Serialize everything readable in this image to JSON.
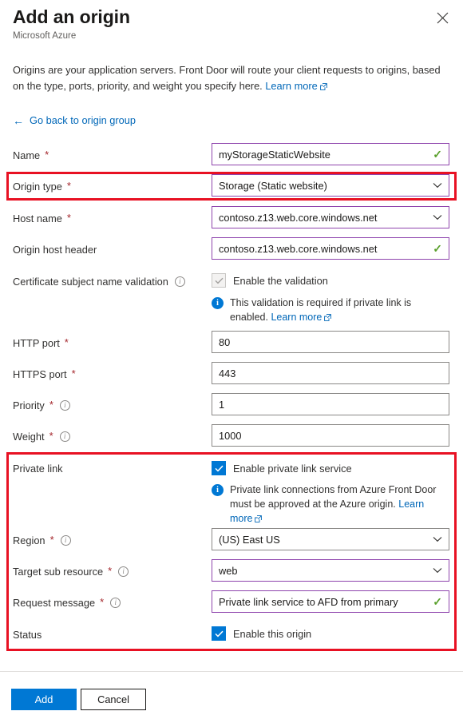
{
  "header": {
    "title": "Add an origin",
    "subtitle": "Microsoft Azure",
    "close_icon": "close-icon"
  },
  "intro": {
    "text": "Origins are your application servers. Front Door will route your client requests to origins, based on the type, ports, priority, and weight you specify here. ",
    "learn_more": "Learn more"
  },
  "back_link": {
    "arrow": "←",
    "label": "Go back to origin group"
  },
  "fields": {
    "name": {
      "label": "Name",
      "required": "*",
      "value": "myStorageStaticWebsite",
      "validation": "✓"
    },
    "origin_type": {
      "label": "Origin type",
      "required": "*",
      "value": "Storage (Static website)"
    },
    "host_name": {
      "label": "Host name",
      "required": "*",
      "value": "contoso.z13.web.core.windows.net"
    },
    "origin_host_header": {
      "label": "Origin host header",
      "value": "contoso.z13.web.core.windows.net",
      "validation": "✓"
    },
    "cert_validation": {
      "label": "Certificate subject name validation",
      "checkbox_label": "Enable the validation",
      "checked": true,
      "disabled": true,
      "info_text": "This validation is required if private link is enabled. ",
      "info_link": "Learn more"
    },
    "http_port": {
      "label": "HTTP port",
      "required": "*",
      "value": "80"
    },
    "https_port": {
      "label": "HTTPS port",
      "required": "*",
      "value": "443"
    },
    "priority": {
      "label": "Priority",
      "required": "*",
      "value": "1"
    },
    "weight": {
      "label": "Weight",
      "required": "*",
      "value": "1000"
    },
    "private_link": {
      "label": "Private link",
      "checkbox_label": "Enable private link service",
      "checked": true,
      "info_text": "Private link connections from Azure Front Door must be approved at the Azure origin. ",
      "info_link": "Learn more"
    },
    "region": {
      "label": "Region",
      "required": "*",
      "value": "(US) East US"
    },
    "target_sub_resource": {
      "label": "Target sub resource",
      "required": "*",
      "value": "web"
    },
    "request_message": {
      "label": "Request message",
      "required": "*",
      "value": "Private link service to AFD from primary",
      "validation": "✓"
    },
    "status": {
      "label": "Status",
      "checkbox_label": "Enable this origin",
      "checked": true
    }
  },
  "footer": {
    "add_label": "Add",
    "cancel_label": "Cancel"
  },
  "colors": {
    "accent": "#0078d4",
    "link": "#0067b8",
    "required": "#a4262c",
    "highlight": "#e81123",
    "field_border_focus": "#8e44ad",
    "valid_check": "#5aa02c"
  }
}
